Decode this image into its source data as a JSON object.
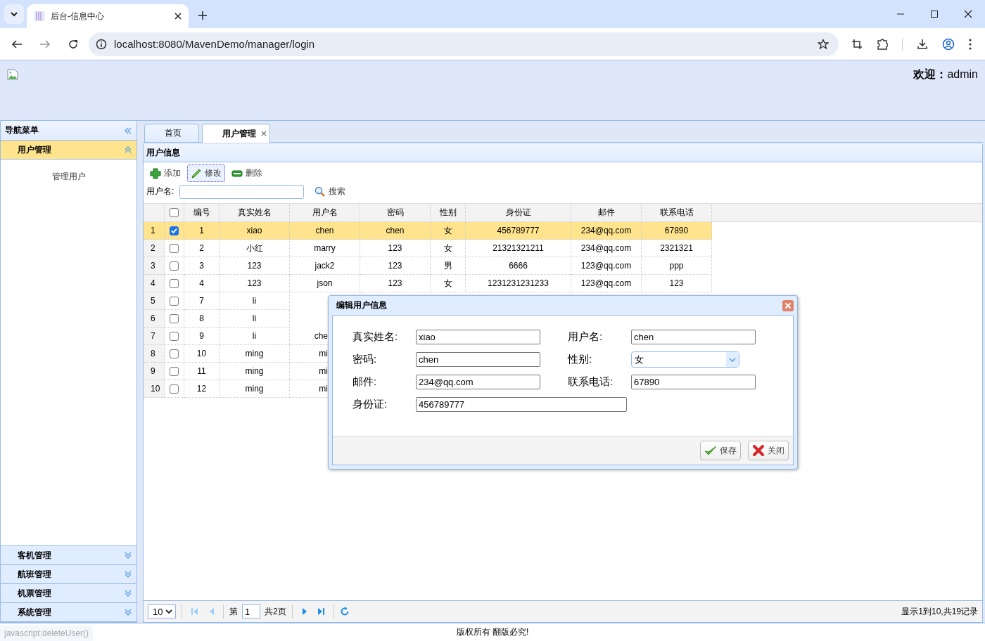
{
  "browser": {
    "tab_title": "后台-信息中心",
    "url": "localhost:8080/MavenDemo/manager/login"
  },
  "header": {
    "welcome": "**欢迎：**admin"
  },
  "nav": {
    "title": "导航菜单",
    "panels": [
      {
        "label": "用户管理",
        "expanded": true,
        "items": [
          "管理用户"
        ]
      },
      {
        "label": "客机管理",
        "expanded": false
      },
      {
        "label": "航班管理",
        "expanded": false
      },
      {
        "label": "机票管理",
        "expanded": false
      },
      {
        "label": "系统管理",
        "expanded": false
      }
    ]
  },
  "tabs": [
    {
      "label": "首页",
      "selected": false,
      "closable": false
    },
    {
      "label": "用户管理",
      "selected": true,
      "closable": true
    }
  ],
  "panel_title": "用户信息",
  "toolbar": [
    {
      "kind": "add",
      "label": "添加",
      "focused": false
    },
    {
      "kind": "edit",
      "label": "修改",
      "focused": true
    },
    {
      "kind": "delete",
      "label": "删除",
      "focused": false
    }
  ],
  "search": {
    "label": "用户名:",
    "button": "搜索"
  },
  "table": {
    "select_all_checked": false,
    "columns": [
      "编号",
      "真实姓名",
      "用户名",
      "密码",
      "性别",
      "身份证",
      "邮件",
      "联系电话"
    ],
    "rows": [
      {
        "row_number": "1",
        "checked": true,
        "selected": true,
        "cells": [
          "1",
          "xiao",
          "chen",
          "chen",
          "女",
          "456789777",
          "234@qq.com",
          "67890"
        ]
      },
      {
        "row_number": "2",
        "checked": false,
        "selected": false,
        "cells": [
          "2",
          "小红",
          "marry",
          "123",
          "女",
          "21321321211",
          "234@qq.com",
          "2321321"
        ]
      },
      {
        "row_number": "3",
        "checked": false,
        "selected": false,
        "cells": [
          "3",
          "123",
          "jack2",
          "123",
          "男",
          "6666",
          "123@qq.com",
          "ppp"
        ]
      },
      {
        "row_number": "4",
        "checked": false,
        "selected": false,
        "cells": [
          "4",
          "123",
          "json",
          "123",
          "女",
          "1231231231233",
          "123@qq.com",
          "123"
        ]
      },
      {
        "row_number": "5",
        "checked": false,
        "selected": false,
        "cells": [
          "7",
          "li"
        ]
      },
      {
        "row_number": "6",
        "checked": false,
        "selected": false,
        "cells": [
          "8",
          "li"
        ]
      },
      {
        "row_number": "7",
        "checked": false,
        "selected": false,
        "cells": [
          "9",
          "li",
          "che"
        ]
      },
      {
        "row_number": "8",
        "checked": false,
        "selected": false,
        "cells": [
          "10",
          "ming",
          "mi"
        ]
      },
      {
        "row_number": "9",
        "checked": false,
        "selected": false,
        "cells": [
          "11",
          "ming",
          "mi"
        ]
      },
      {
        "row_number": "10",
        "checked": false,
        "selected": false,
        "cells": [
          "12",
          "ming",
          "mi"
        ]
      }
    ]
  },
  "pager": {
    "page_size": "10",
    "page_prefix": "第",
    "page": "1",
    "total": "共2页",
    "info": "显示1到10,共19记录",
    "buttons": [
      {
        "kind": "first",
        "disabled": true
      },
      {
        "kind": "prev",
        "disabled": true
      },
      {
        "kind": "next",
        "disabled": false
      },
      {
        "kind": "last",
        "disabled": false
      }
    ]
  },
  "dialog": {
    "title": "编辑用户信息",
    "fields": [
      {
        "label": "真实姓名:",
        "value": "xiao",
        "kind": "text",
        "wide": false
      },
      {
        "label": "用户名:",
        "value": "chen",
        "kind": "text",
        "wide": false
      },
      {
        "label": "密码:",
        "value": "chen",
        "kind": "text",
        "wide": false
      },
      {
        "label": "性别:",
        "value": "女",
        "kind": "select",
        "wide": false
      },
      {
        "label": "邮件:",
        "value": "234@qq.com",
        "kind": "text",
        "wide": false
      },
      {
        "label": "联系电话:",
        "value": "67890",
        "kind": "text",
        "wide": false
      },
      {
        "label": "身份证:",
        "value": "456789777",
        "kind": "text",
        "wide": true
      }
    ],
    "buttons": [
      {
        "kind": "save",
        "label": "保存"
      },
      {
        "kind": "close",
        "label": "关闭"
      }
    ]
  },
  "footer": "版权所有 翻版必究!",
  "status_url": "javascript:deleteUser()"
}
